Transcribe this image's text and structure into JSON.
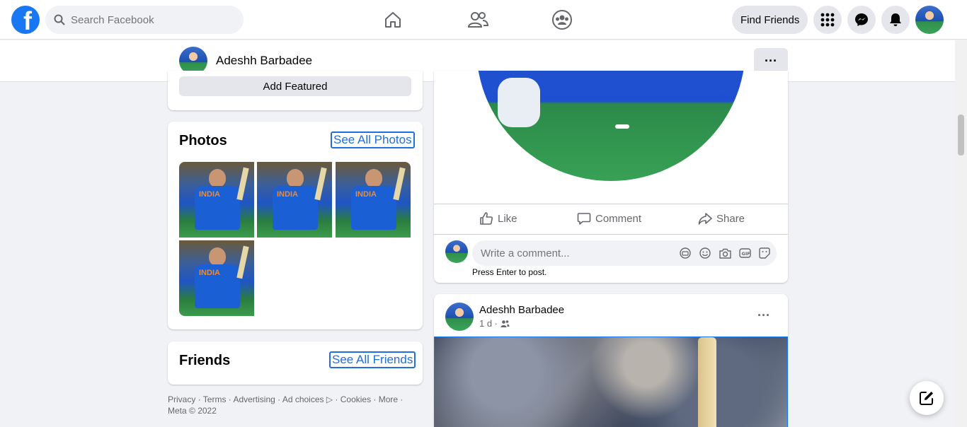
{
  "topbar": {
    "logo_letter": "f",
    "search_placeholder": "Search Facebook",
    "find_friends_label": "Find Friends"
  },
  "profile_bar": {
    "name": "Adeshh Barbadee",
    "more_label": "···"
  },
  "featured": {
    "add_featured_label": "Add Featured"
  },
  "photos": {
    "title": "Photos",
    "see_all_label": "See All Photos",
    "items": [
      {
        "text": "INDIA"
      },
      {
        "text": "INDIA"
      },
      {
        "text": "INDIA"
      },
      {
        "text": "INDIA"
      }
    ]
  },
  "friends": {
    "title": "Friends",
    "see_all_label": "See All Friends"
  },
  "footer": {
    "links": "Privacy · Terms · Advertising · Ad choices ▷ · Cookies · More ·",
    "copyright": "Meta © 2022"
  },
  "post1": {
    "actions": {
      "like": "Like",
      "comment": "Comment",
      "share": "Share"
    },
    "comment_placeholder": "Write a comment...",
    "press_enter": "Press Enter to post."
  },
  "post2": {
    "author": "Adeshh Barbadee",
    "time": "1 d ·",
    "more_label": "···"
  },
  "colors": {
    "brand": "#1877f2",
    "link": "#216fdb",
    "background": "#f0f2f5"
  }
}
